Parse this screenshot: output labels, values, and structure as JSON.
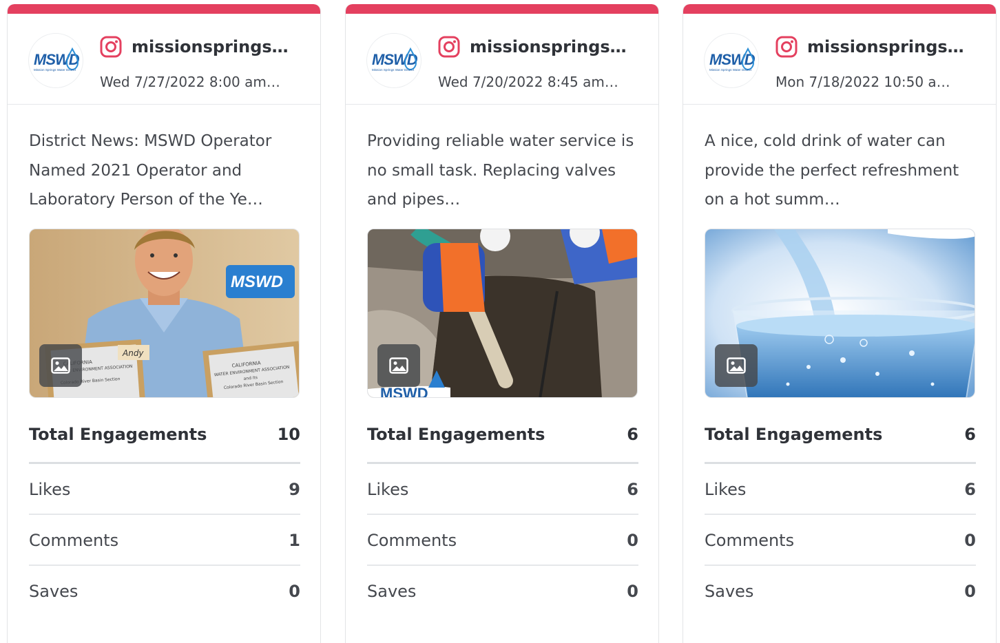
{
  "accent_color": "#e4405f",
  "posts": [
    {
      "network_icon": "instagram-icon",
      "handle": "missionsprings…",
      "date": "Wed 7/27/2022 8:00 am…",
      "caption": "District News: MSWD Operator Named 2021 Operator and Laboratory Person of the Ye…",
      "media_type": "image-icon",
      "stats": [
        {
          "label": "Total Engagements",
          "value": "10"
        },
        {
          "label": "Likes",
          "value": "9"
        },
        {
          "label": "Comments",
          "value": "1"
        },
        {
          "label": "Saves",
          "value": "0"
        }
      ]
    },
    {
      "network_icon": "instagram-icon",
      "handle": "missionsprings…",
      "date": "Wed 7/20/2022 8:45 am…",
      "caption": "Providing reliable water service is no small task. Replacing valves and pipes…",
      "media_type": "image-icon",
      "stats": [
        {
          "label": "Total Engagements",
          "value": "6"
        },
        {
          "label": "Likes",
          "value": "6"
        },
        {
          "label": "Comments",
          "value": "0"
        },
        {
          "label": "Saves",
          "value": "0"
        }
      ]
    },
    {
      "network_icon": "instagram-icon",
      "handle": "missionsprings…",
      "date": "Mon 7/18/2022 10:50 a…",
      "caption": "A nice, cold drink of water can provide the perfect refreshment on a hot summ…",
      "media_type": "image-icon",
      "stats": [
        {
          "label": "Total Engagements",
          "value": "6"
        },
        {
          "label": "Likes",
          "value": "6"
        },
        {
          "label": "Comments",
          "value": "0"
        },
        {
          "label": "Saves",
          "value": "0"
        }
      ]
    }
  ],
  "logo": {
    "text": "MSWD",
    "subtext": "Mission Springs Water District"
  },
  "photo_texts": {
    "award_name": "Andy",
    "award_line1": "CALIFORNIA",
    "award_line2": "WATER ENVIRONMENT ASSOCIATION",
    "award_line3": "and its",
    "award_line4": "Colorado River Basin Section"
  }
}
